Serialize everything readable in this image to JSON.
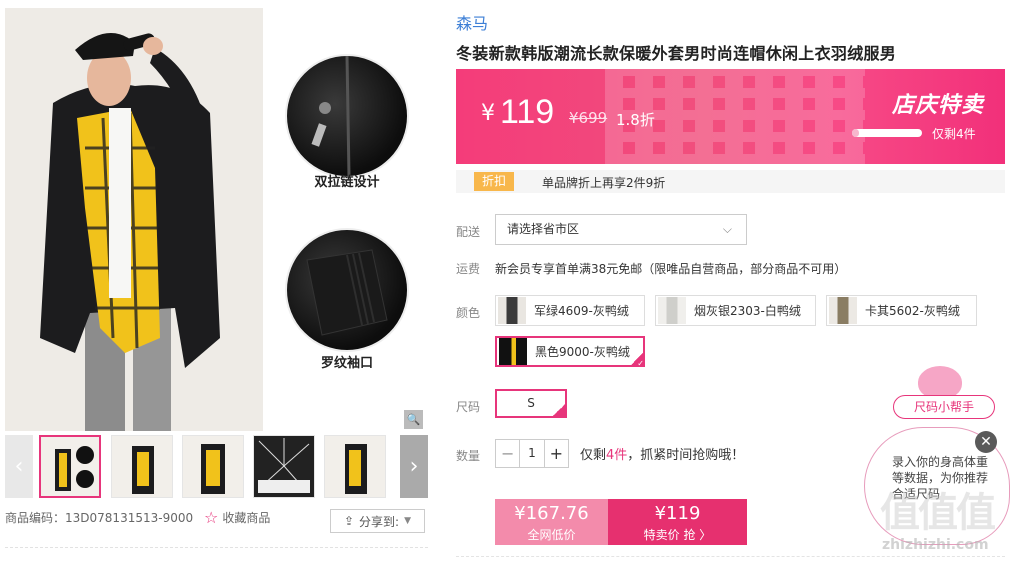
{
  "product": {
    "brand": "森马",
    "title": "冬装新款韩版潮流长款保暖外套男时尚连帽休闲上衣羽绒服男",
    "detail_1": "双拉链设计",
    "detail_2": "罗纹袖口",
    "code_label": "商品编码：",
    "code": "13D078131513-9000",
    "favorite": "收藏商品",
    "share": "分享到:"
  },
  "price": {
    "currency": "¥",
    "current": "119",
    "original": "¥699",
    "discount": "1.8折",
    "event": "店庆特卖",
    "remaining": "仅剩4件",
    "remaining_fraction": 0.1
  },
  "promo": {
    "tag": "折扣",
    "text": "单品牌折上再享2件9折"
  },
  "delivery": {
    "label": "配送",
    "placeholder": "请选择省市区"
  },
  "shipping": {
    "label": "运费",
    "text": "新会员专享首单满38元免邮（限唯品自营商品，部分商品不可用）"
  },
  "colors": {
    "label": "颜色",
    "options": [
      "军绿4609-灰鸭绒",
      "烟灰银2303-白鸭绒",
      "卡其5602-灰鸭绒",
      "黑色9000-灰鸭绒"
    ],
    "selected": "黑色9000-灰鸭绒"
  },
  "size": {
    "label": "尺码",
    "options": [
      "S"
    ],
    "selected": "S"
  },
  "quantity": {
    "label": "数量",
    "minus": "−",
    "plus": "+",
    "value": "1",
    "note_prefix": "仅剩",
    "note_count": "4件",
    "note_suffix": "，抓紧时间抢购哦！"
  },
  "buttons": {
    "all_price": "¥167.76",
    "all_label": "全网低价",
    "sale_price": "¥119",
    "sale_label": "特卖价 抢 〉"
  },
  "helper": {
    "tag": "尺码小帮手",
    "text": "录入你的身高体重等数据，为你推荐合适尺码",
    "close": "✕"
  },
  "watermark": {
    "logo": "值值值",
    "url": "zhizhizhi.com"
  },
  "colors_theme": {
    "accent": "#e7357b",
    "brand_link": "#3d7fd6",
    "banner": "#f43c7a",
    "promo_tag": "#f8b74b"
  }
}
